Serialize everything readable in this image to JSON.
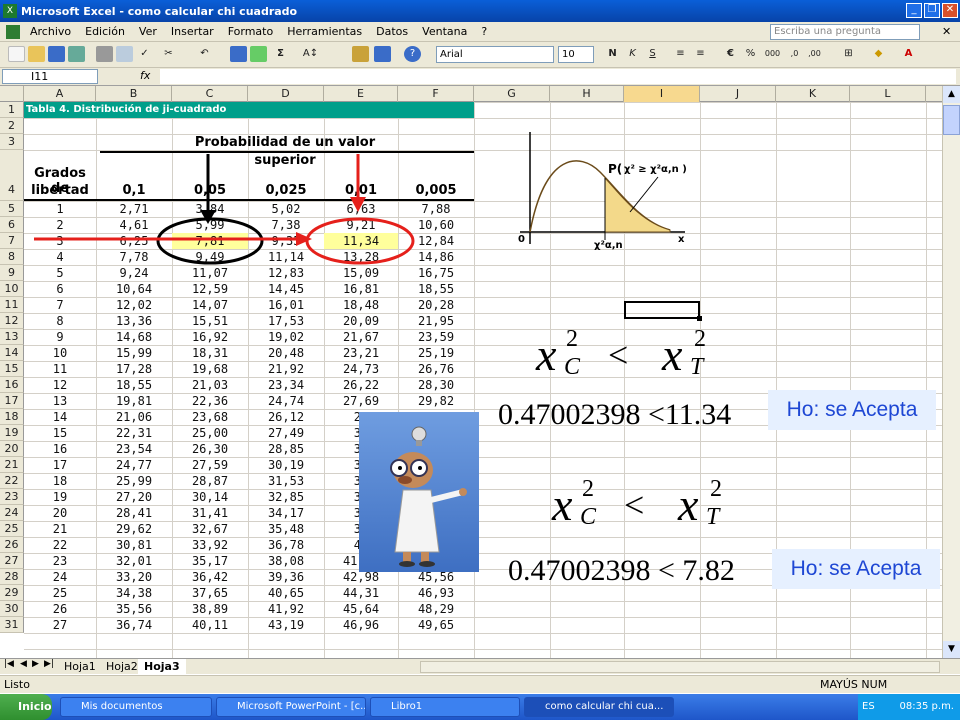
{
  "window": {
    "title": "Microsoft Excel - como calcular chi cuadrado"
  },
  "menu": {
    "items": [
      "Archivo",
      "Edición",
      "Ver",
      "Insertar",
      "Formato",
      "Herramientas",
      "Datos",
      "Ventana",
      "?"
    ],
    "help_placeholder": "Escriba una pregunta"
  },
  "toolbar": {
    "font_name": "Arial",
    "font_size": "10",
    "zoom_glyph": "Σ"
  },
  "formula": {
    "name_box": "I11",
    "fx": "fx",
    "content": ""
  },
  "columns": [
    "A",
    "B",
    "C",
    "D",
    "E",
    "F",
    "G",
    "H",
    "I",
    "J",
    "K",
    "L"
  ],
  "rows": [
    "1",
    "2",
    "3",
    "4",
    "5",
    "6",
    "7",
    "8",
    "9",
    "10",
    "11",
    "12",
    "13",
    "14",
    "15",
    "16",
    "17",
    "18",
    "19",
    "20",
    "21",
    "22",
    "23",
    "24",
    "25",
    "26",
    "27",
    "28",
    "29",
    "30",
    "31"
  ],
  "table": {
    "title": "Tabla 4. Distribución de ji-cuadrado",
    "header_span": "Probabilidad de un valor superior",
    "first_col_header_line1": "Grados de",
    "first_col_header_line2": "libertad",
    "probabilities": [
      "0,1",
      "0,05",
      "0,025",
      "0,01",
      "0,005"
    ],
    "rows": [
      [
        "1",
        "2,71",
        "3,84",
        "5,02",
        "6,63",
        "7,88"
      ],
      [
        "2",
        "4,61",
        "5,99",
        "7,38",
        "9,21",
        "10,60"
      ],
      [
        "3",
        "6,25",
        "7,81",
        "9,35",
        "11,34",
        "12,84"
      ],
      [
        "4",
        "7,78",
        "9,49",
        "11,14",
        "13,28",
        "14,86"
      ],
      [
        "5",
        "9,24",
        "11,07",
        "12,83",
        "15,09",
        "16,75"
      ],
      [
        "6",
        "10,64",
        "12,59",
        "14,45",
        "16,81",
        "18,55"
      ],
      [
        "7",
        "12,02",
        "14,07",
        "16,01",
        "18,48",
        "20,28"
      ],
      [
        "8",
        "13,36",
        "15,51",
        "17,53",
        "20,09",
        "21,95"
      ],
      [
        "9",
        "14,68",
        "16,92",
        "19,02",
        "21,67",
        "23,59"
      ],
      [
        "10",
        "15,99",
        "18,31",
        "20,48",
        "23,21",
        "25,19"
      ],
      [
        "11",
        "17,28",
        "19,68",
        "21,92",
        "24,73",
        "26,76"
      ],
      [
        "12",
        "18,55",
        "21,03",
        "23,34",
        "26,22",
        "28,30"
      ],
      [
        "13",
        "19,81",
        "22,36",
        "24,74",
        "27,69",
        "29,82"
      ],
      [
        "14",
        "21,06",
        "23,68",
        "26,12",
        "29",
        "31"
      ],
      [
        "15",
        "22,31",
        "25,00",
        "27,49",
        "30",
        "32"
      ],
      [
        "16",
        "23,54",
        "26,30",
        "28,85",
        "32",
        "34"
      ],
      [
        "17",
        "24,77",
        "27,59",
        "30,19",
        "33",
        "35"
      ],
      [
        "18",
        "25,99",
        "28,87",
        "31,53",
        "34",
        "37"
      ],
      [
        "19",
        "27,20",
        "30,14",
        "32,85",
        "36",
        "38"
      ],
      [
        "20",
        "28,41",
        "31,41",
        "34,17",
        "37",
        "40"
      ],
      [
        "21",
        "29,62",
        "32,67",
        "35,48",
        "38",
        "41"
      ],
      [
        "22",
        "30,81",
        "33,92",
        "36,78",
        "40",
        "42"
      ],
      [
        "23",
        "32,01",
        "35,17",
        "38,08",
        "41,64",
        "44,18"
      ],
      [
        "24",
        "33,20",
        "36,42",
        "39,36",
        "42,98",
        "45,56"
      ],
      [
        "25",
        "34,38",
        "37,65",
        "40,65",
        "44,31",
        "46,93"
      ],
      [
        "26",
        "35,56",
        "38,89",
        "41,92",
        "45,64",
        "48,29"
      ],
      [
        "27",
        "36,74",
        "40,11",
        "43,19",
        "46,96",
        "49,65"
      ]
    ]
  },
  "diagram": {
    "label_prob": "P(",
    "label_chi": "χ² ≥ χ²α,n )",
    "label_zero": "0",
    "label_x": "x",
    "label_crit": "χ²α,n"
  },
  "equations": {
    "ineq1_x": "x",
    "ineq1_sub1": "C",
    "ineq1_sup1": "2",
    "ineq1_op": "<",
    "ineq1_sub2": "T",
    "ineq1_sup2": "2",
    "value1": "0.47002398 <11.34",
    "accept1": "Ho: se Acepta",
    "ineq2_x": "x",
    "ineq2_sub1": "C",
    "ineq2_sup1": "2",
    "ineq2_op": "<",
    "ineq2_sub2": "T",
    "ineq2_sup2": "2",
    "value2": "0.47002398 < 7.82",
    "accept2": "Ho: se Acepta"
  },
  "sheet_tabs": [
    "Hoja1",
    "Hoja2",
    "Hoja3"
  ],
  "active_sheet": "Hoja3",
  "status": {
    "left": "Listo",
    "right": "MAYÚS NUM"
  },
  "taskbar": {
    "start": "Inicio",
    "tasks": [
      "Mis documentos",
      "Microsoft PowerPoint - [c...",
      "Libro1",
      "como calcular chi cua..."
    ],
    "lang": "ES",
    "time": "08:35 p.m."
  },
  "colors": {
    "table_header_bg": "#009f8a",
    "highlight": "#ffff9c",
    "accept_text": "#1e47d4",
    "accept_bg": "#e6f0ff"
  }
}
